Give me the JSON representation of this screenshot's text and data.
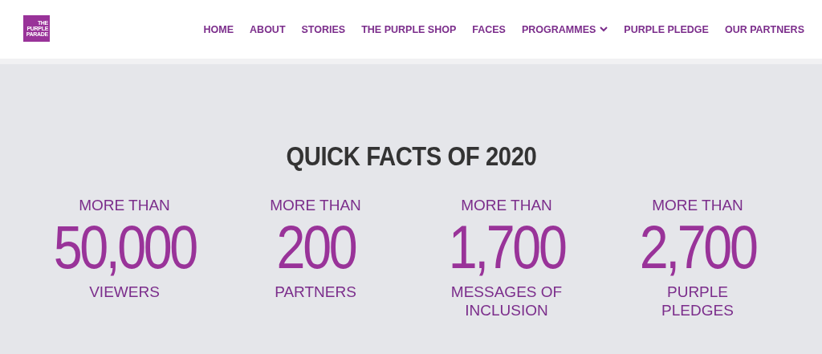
{
  "logo": {
    "lines": [
      "THE",
      "PURPLE",
      "PARADE"
    ]
  },
  "nav": [
    {
      "label": "HOME",
      "has_menu": false
    },
    {
      "label": "ABOUT",
      "has_menu": false
    },
    {
      "label": "STORIES",
      "has_menu": false
    },
    {
      "label": "THE PURPLE SHOP",
      "has_menu": false
    },
    {
      "label": "FACES",
      "has_menu": false
    },
    {
      "label": "PROGRAMMES",
      "has_menu": true
    },
    {
      "label": "PURPLE PLEDGE",
      "has_menu": false
    },
    {
      "label": "OUR PARTNERS",
      "has_menu": false
    }
  ],
  "facts": {
    "title": "QUICK FACTS OF 2020",
    "items": [
      {
        "prefix": "MORE THAN",
        "number": "50,000",
        "caption": "VIEWERS"
      },
      {
        "prefix": "MORE THAN",
        "number": "200",
        "caption": "PARTNERS"
      },
      {
        "prefix": "MORE THAN",
        "number": "1,700",
        "caption": "MESSAGES OF INCLUSION"
      },
      {
        "prefix": "MORE THAN",
        "number": "2,700",
        "caption": "PURPLE PLEDGES"
      }
    ]
  }
}
